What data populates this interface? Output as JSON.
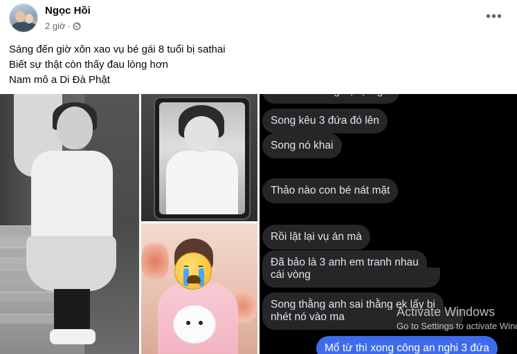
{
  "post": {
    "author": "Ngọc Hồi",
    "time": "2 giờ",
    "separator": "·",
    "privacy_icon": "globe-icon",
    "more_icon": "more-options-icon",
    "more_label": "•••",
    "caption_lines": [
      "Sáng đến giờ xôn xao vụ bé gái 8 tuổi bị sathai",
      "Biết sự thật còn thấy đau lòng hơn",
      "Nam mô a Di Đà Phật"
    ]
  },
  "chat": {
    "messages": [
      {
        "text": "Mổ từ thì xong họ tự nghi",
        "sender": "other"
      },
      {
        "text": "Song kêu 3 đứa đó lên",
        "sender": "other"
      },
      {
        "text": "Song nó khai",
        "sender": "other"
      },
      {
        "text": "Thảo nào con bé nát mặt",
        "sender": "other"
      },
      {
        "text": "Rồi lật lại vụ án mà",
        "sender": "other"
      },
      {
        "text": "Đã bảo là 3 anh em tranh nhau",
        "sender": "other"
      },
      {
        "text": "cái vòng",
        "sender": "other"
      },
      {
        "text": "Song thằng anh sai thằng ek lấy bi",
        "sender": "other"
      },
      {
        "text": "nhét nó vào ma",
        "sender": "other"
      },
      {
        "text": "Mổ từ thì xong công an nghi 3 đứa",
        "sender": "me"
      }
    ],
    "colors": {
      "other_bubble": "#262628",
      "my_bubble": "#3e6bea"
    }
  },
  "overlay": {
    "activate_title": "Activate Windows",
    "activate_sub": "Go to Settings to activate Windows."
  },
  "photos": {
    "crying_emoji": "loudly-crying-face-icon"
  }
}
